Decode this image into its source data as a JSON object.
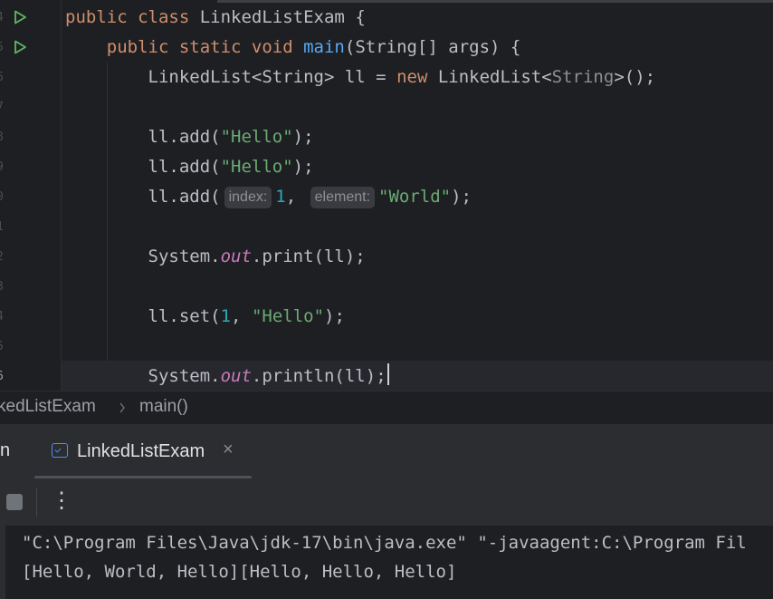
{
  "editor": {
    "line_numbers": [
      "4",
      "5",
      "6",
      "7",
      "8",
      "9",
      "0",
      "1",
      "2",
      "3",
      "4",
      "5",
      "6"
    ],
    "code": {
      "class_decl": {
        "kw": "public class ",
        "name": "LinkedListExam",
        "rest": " {"
      },
      "main_decl": {
        "kw1": "public static void ",
        "fn": "main",
        "rest": "(String[] args) {"
      },
      "new_list": {
        "a": "LinkedList<String> ll = ",
        "kw": "new",
        "b": " LinkedList<",
        "gen": "String",
        "c": ">();"
      },
      "add1": {
        "a": "ll.add(",
        "s": "\"Hello\"",
        "b": ");"
      },
      "add2": {
        "a": "ll.add(",
        "s": "\"Hello\"",
        "b": ");"
      },
      "add3": {
        "a": "ll.add(",
        "hint_index": "index:",
        "n": "1",
        "comma": ",",
        "hint_element": "element:",
        "s": "\"World\"",
        "b": ");"
      },
      "print": {
        "a": "System.",
        "fld": "out",
        "b": ".print(ll);"
      },
      "set": {
        "a": "ll.set(",
        "n": "1",
        "comma": ", ",
        "s": "\"Hello\"",
        "b": ");"
      },
      "println": {
        "a": "System.",
        "fld": "out",
        "b": ".println(ll);"
      }
    }
  },
  "breadcrumb": {
    "class": "kedListExam",
    "method": "main()"
  },
  "tool_window": {
    "label": "n",
    "tab_label": "LinkedListExam",
    "tab_close": "×",
    "more": "⋮"
  },
  "console": {
    "lines": [
      "\"C:\\Program Files\\Java\\jdk-17\\bin\\java.exe\" \"-javaagent:C:\\Program Fil",
      "[Hello, World, Hello][Hello, Hello, Hello]"
    ]
  },
  "colors": {
    "background": "#1e1f22",
    "keyword": "#cf8e6d",
    "function": "#56a8f5",
    "string": "#6aab73",
    "number": "#2aacb8",
    "field": "#c77dbb",
    "run_icon": "#5fb865"
  },
  "icons": [
    "run-gutter-icon",
    "chevron-right-icon",
    "run-config-icon",
    "close-icon",
    "stop-icon",
    "more-vertical-icon"
  ]
}
